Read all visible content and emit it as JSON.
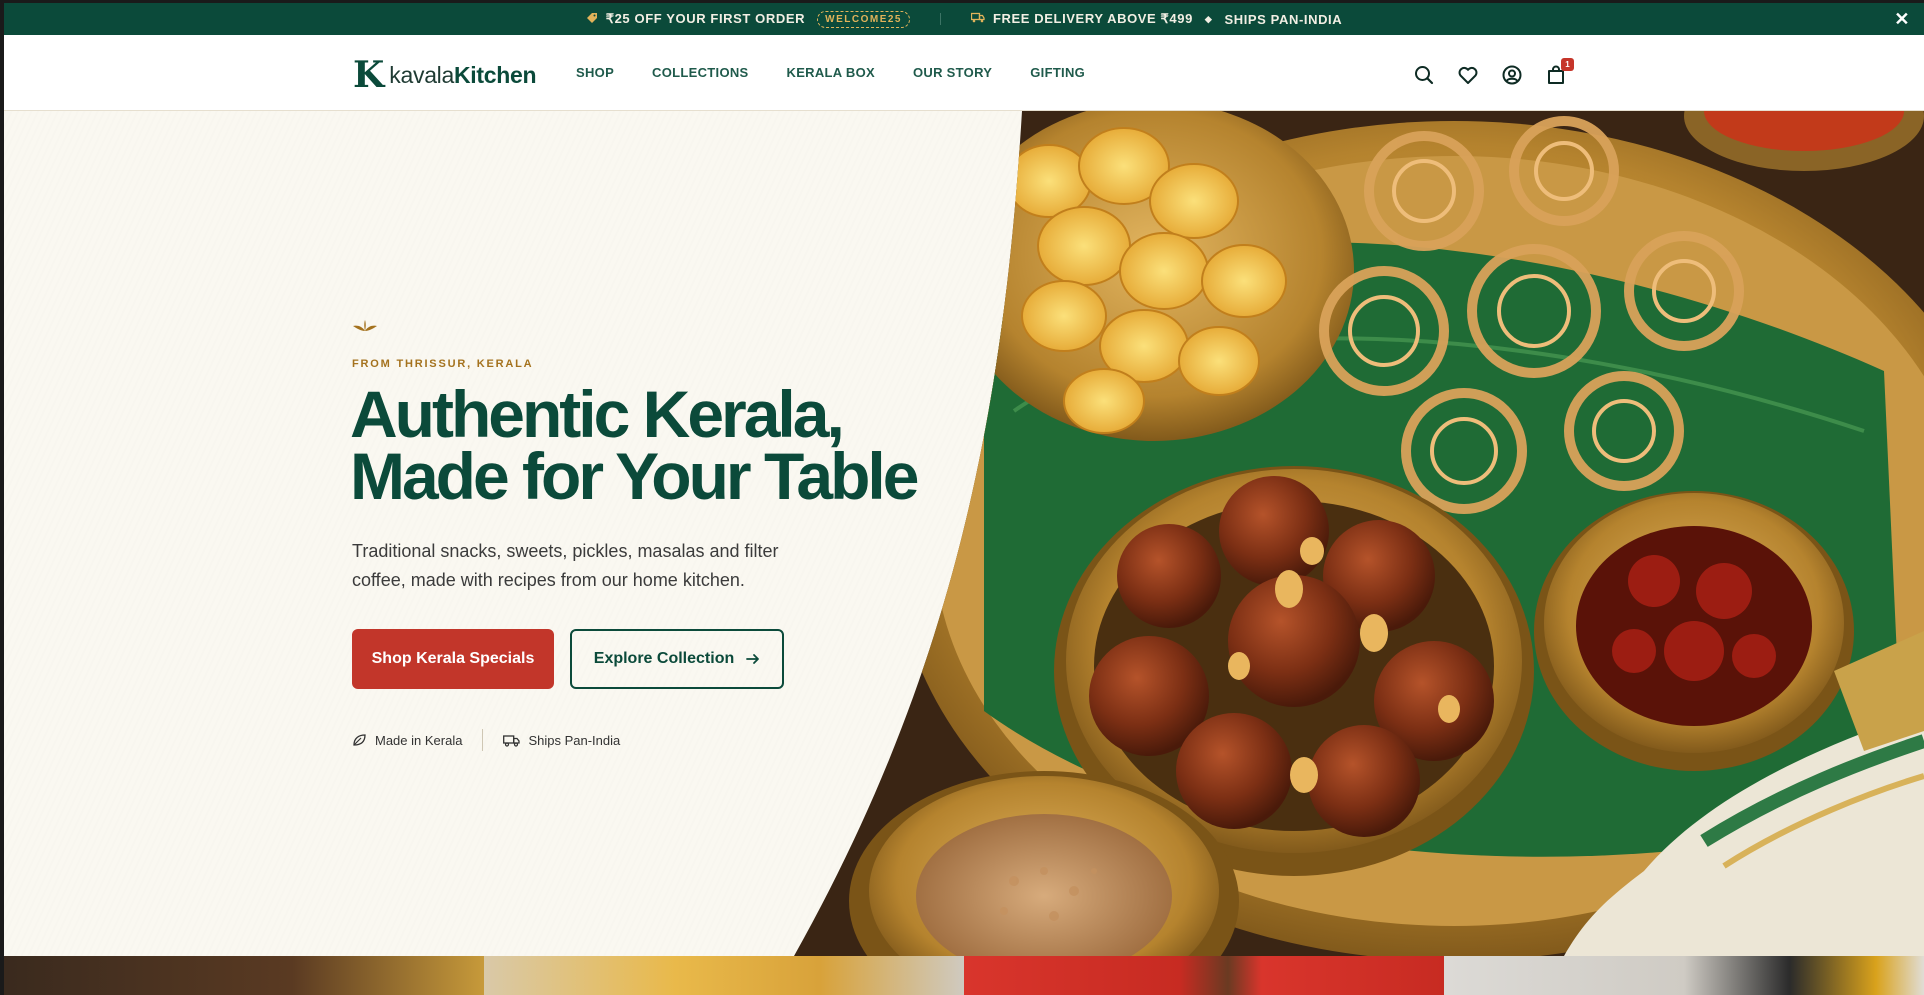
{
  "announcement": {
    "offer_text": "₹25 OFF YOUR FIRST ORDER",
    "promo_code": "WELCOME25",
    "delivery_text": "FREE DELIVERY ABOVE ₹499",
    "ship_text": "SHIPS PAN-INDIA",
    "close_label": "✕"
  },
  "header": {
    "logo": {
      "mark": "K",
      "part1": "kavala",
      "part2": "Kitchen"
    },
    "nav": [
      "SHOP",
      "COLLECTIONS",
      "KERALA BOX",
      "OUR STORY",
      "GIFTING"
    ],
    "cart_count": "1"
  },
  "hero": {
    "eyebrow": "FROM THRISSUR, KERALA",
    "headline_line1": "Authentic Kerala,",
    "headline_line2": "Made for Your Table",
    "subtext": "Traditional snacks, sweets, pickles, masalas and filter coffee, made with recipes from our home kitchen.",
    "primary_cta": "Shop Kerala Specials",
    "secondary_cta": "Explore Collection",
    "trust": [
      "Made in Kerala",
      "Ships Pan-India"
    ]
  },
  "colors": {
    "brand_green": "#0b4a3a",
    "accent_red": "#c2362a",
    "gold": "#a4721e",
    "cream": "#faf8f1"
  }
}
